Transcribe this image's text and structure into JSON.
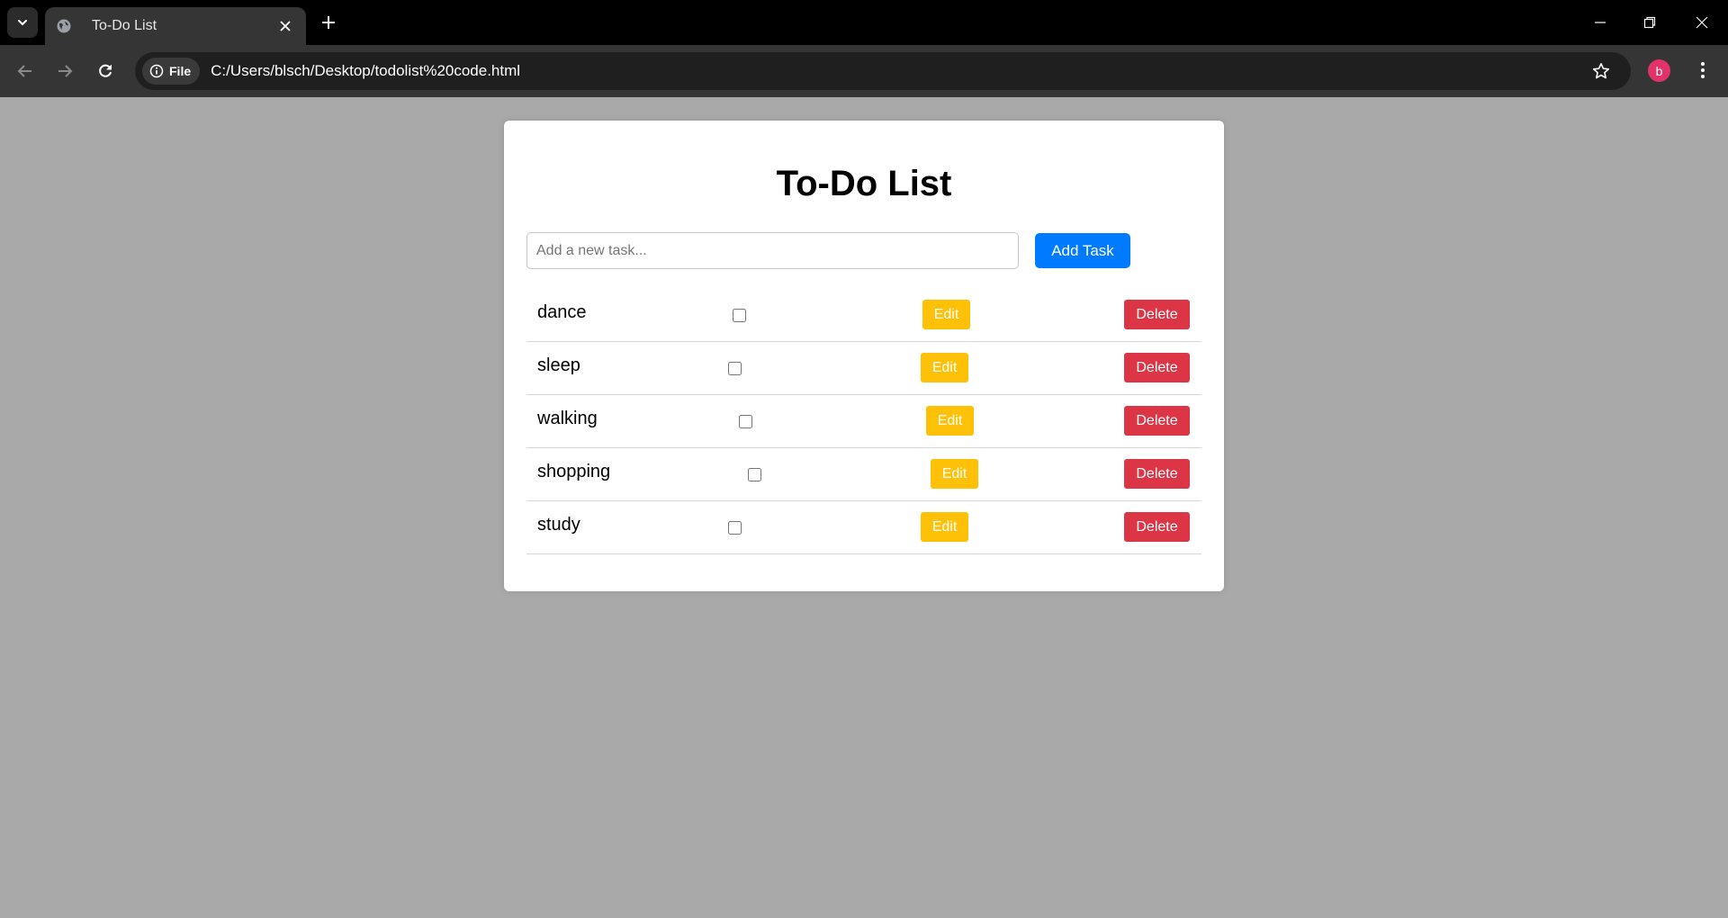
{
  "browser": {
    "tab_title": "To-Do List",
    "chip_label": "File",
    "url": "C:/Users/blsch/Desktop/todolist%20code.html",
    "profile_initial": "b",
    "profile_color": "#e2326a"
  },
  "page": {
    "title": "To-Do List",
    "input_placeholder": "Add a new task...",
    "add_button": "Add Task",
    "edit_label": "Edit",
    "delete_label": "Delete",
    "tasks": [
      {
        "text": "dance",
        "checked": false
      },
      {
        "text": "sleep",
        "checked": false
      },
      {
        "text": "walking",
        "checked": false
      },
      {
        "text": "shopping",
        "checked": false
      },
      {
        "text": "study",
        "checked": false
      }
    ]
  },
  "colors": {
    "page_background": "#a9a9a9",
    "add_button": "#007bff",
    "edit_button": "#ffc107",
    "delete_button": "#dc3545"
  }
}
